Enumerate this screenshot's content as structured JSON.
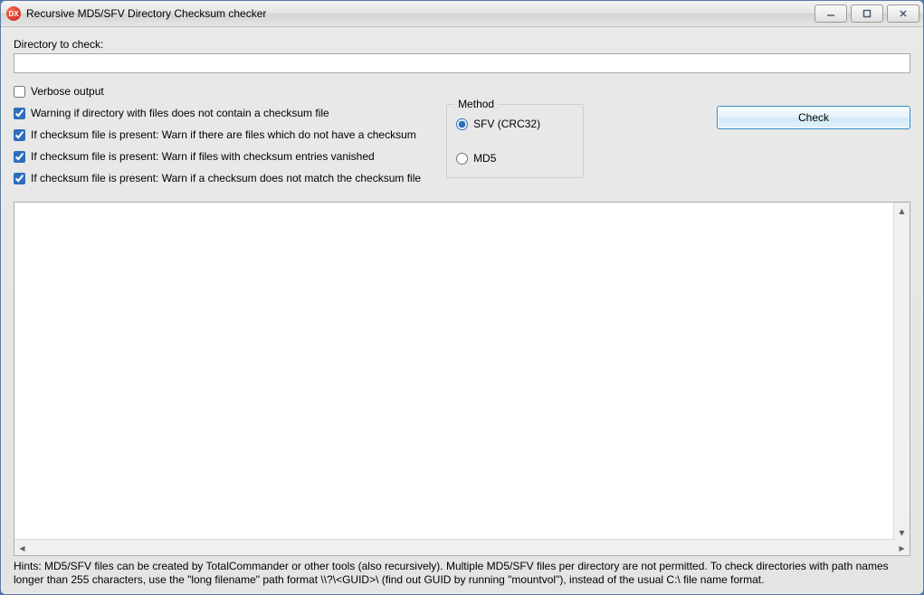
{
  "window": {
    "title": "Recursive MD5/SFV Directory Checksum checker"
  },
  "form": {
    "directory_label": "Directory to check:",
    "directory_value": ""
  },
  "options": {
    "verbose": {
      "label": "Verbose output",
      "checked": false
    },
    "warn_no_cksum": {
      "label": "Warning if directory with files does not contain a checksum file",
      "checked": true
    },
    "warn_missing": {
      "label": "If checksum file is present: Warn if there are files which do not have a checksum",
      "checked": true
    },
    "warn_vanished": {
      "label": "If checksum file is present: Warn if files with checksum entries vanished",
      "checked": true
    },
    "warn_mismatch": {
      "label": "If checksum file is present: Warn if a checksum does not match the checksum file",
      "checked": true
    }
  },
  "method": {
    "legend": "Method",
    "sfv_label": "SFV (CRC32)",
    "md5_label": "MD5",
    "selected": "sfv"
  },
  "actions": {
    "check_label": "Check"
  },
  "output_text": "",
  "hints": "Hints: MD5/SFV files can be created by TotalCommander or other tools (also recursively).  Multiple MD5/SFV files per directory are not permitted.  To check directories with path names longer than 255 characters, use the \"long filename\" path format \\\\?\\<GUID>\\  (find out GUID by running \"mountvol\"), instead of the usual C:\\  file name format."
}
